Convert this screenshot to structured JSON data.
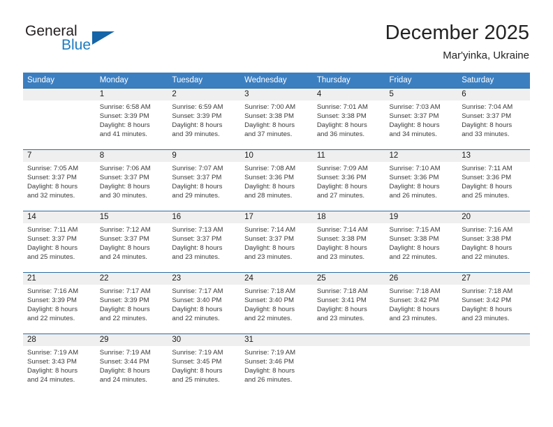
{
  "brand": {
    "name_part1": "General",
    "name_part2": "Blue",
    "logo_icon": "triangle-logo-icon"
  },
  "header": {
    "title": "December 2025",
    "location": "Mar'yinka, Ukraine"
  },
  "calendar": {
    "weekday_headers": [
      "Sunday",
      "Monday",
      "Tuesday",
      "Wednesday",
      "Thursday",
      "Friday",
      "Saturday"
    ],
    "colors": {
      "header_blue": "#3c7fc1",
      "rule_blue": "#2e6da4",
      "daynum_band": "#efefef",
      "brand_blue": "#1b7bc1"
    },
    "weeks": [
      {
        "days": [
          {
            "num": "",
            "sunrise": "",
            "sunset": "",
            "daylight1": "",
            "daylight2": ""
          },
          {
            "num": "1",
            "sunrise": "Sunrise: 6:58 AM",
            "sunset": "Sunset: 3:39 PM",
            "daylight1": "Daylight: 8 hours",
            "daylight2": "and 41 minutes."
          },
          {
            "num": "2",
            "sunrise": "Sunrise: 6:59 AM",
            "sunset": "Sunset: 3:39 PM",
            "daylight1": "Daylight: 8 hours",
            "daylight2": "and 39 minutes."
          },
          {
            "num": "3",
            "sunrise": "Sunrise: 7:00 AM",
            "sunset": "Sunset: 3:38 PM",
            "daylight1": "Daylight: 8 hours",
            "daylight2": "and 37 minutes."
          },
          {
            "num": "4",
            "sunrise": "Sunrise: 7:01 AM",
            "sunset": "Sunset: 3:38 PM",
            "daylight1": "Daylight: 8 hours",
            "daylight2": "and 36 minutes."
          },
          {
            "num": "5",
            "sunrise": "Sunrise: 7:03 AM",
            "sunset": "Sunset: 3:37 PM",
            "daylight1": "Daylight: 8 hours",
            "daylight2": "and 34 minutes."
          },
          {
            "num": "6",
            "sunrise": "Sunrise: 7:04 AM",
            "sunset": "Sunset: 3:37 PM",
            "daylight1": "Daylight: 8 hours",
            "daylight2": "and 33 minutes."
          }
        ]
      },
      {
        "days": [
          {
            "num": "7",
            "sunrise": "Sunrise: 7:05 AM",
            "sunset": "Sunset: 3:37 PM",
            "daylight1": "Daylight: 8 hours",
            "daylight2": "and 32 minutes."
          },
          {
            "num": "8",
            "sunrise": "Sunrise: 7:06 AM",
            "sunset": "Sunset: 3:37 PM",
            "daylight1": "Daylight: 8 hours",
            "daylight2": "and 30 minutes."
          },
          {
            "num": "9",
            "sunrise": "Sunrise: 7:07 AM",
            "sunset": "Sunset: 3:37 PM",
            "daylight1": "Daylight: 8 hours",
            "daylight2": "and 29 minutes."
          },
          {
            "num": "10",
            "sunrise": "Sunrise: 7:08 AM",
            "sunset": "Sunset: 3:36 PM",
            "daylight1": "Daylight: 8 hours",
            "daylight2": "and 28 minutes."
          },
          {
            "num": "11",
            "sunrise": "Sunrise: 7:09 AM",
            "sunset": "Sunset: 3:36 PM",
            "daylight1": "Daylight: 8 hours",
            "daylight2": "and 27 minutes."
          },
          {
            "num": "12",
            "sunrise": "Sunrise: 7:10 AM",
            "sunset": "Sunset: 3:36 PM",
            "daylight1": "Daylight: 8 hours",
            "daylight2": "and 26 minutes."
          },
          {
            "num": "13",
            "sunrise": "Sunrise: 7:11 AM",
            "sunset": "Sunset: 3:36 PM",
            "daylight1": "Daylight: 8 hours",
            "daylight2": "and 25 minutes."
          }
        ]
      },
      {
        "days": [
          {
            "num": "14",
            "sunrise": "Sunrise: 7:11 AM",
            "sunset": "Sunset: 3:37 PM",
            "daylight1": "Daylight: 8 hours",
            "daylight2": "and 25 minutes."
          },
          {
            "num": "15",
            "sunrise": "Sunrise: 7:12 AM",
            "sunset": "Sunset: 3:37 PM",
            "daylight1": "Daylight: 8 hours",
            "daylight2": "and 24 minutes."
          },
          {
            "num": "16",
            "sunrise": "Sunrise: 7:13 AM",
            "sunset": "Sunset: 3:37 PM",
            "daylight1": "Daylight: 8 hours",
            "daylight2": "and 23 minutes."
          },
          {
            "num": "17",
            "sunrise": "Sunrise: 7:14 AM",
            "sunset": "Sunset: 3:37 PM",
            "daylight1": "Daylight: 8 hours",
            "daylight2": "and 23 minutes."
          },
          {
            "num": "18",
            "sunrise": "Sunrise: 7:14 AM",
            "sunset": "Sunset: 3:38 PM",
            "daylight1": "Daylight: 8 hours",
            "daylight2": "and 23 minutes."
          },
          {
            "num": "19",
            "sunrise": "Sunrise: 7:15 AM",
            "sunset": "Sunset: 3:38 PM",
            "daylight1": "Daylight: 8 hours",
            "daylight2": "and 22 minutes."
          },
          {
            "num": "20",
            "sunrise": "Sunrise: 7:16 AM",
            "sunset": "Sunset: 3:38 PM",
            "daylight1": "Daylight: 8 hours",
            "daylight2": "and 22 minutes."
          }
        ]
      },
      {
        "days": [
          {
            "num": "21",
            "sunrise": "Sunrise: 7:16 AM",
            "sunset": "Sunset: 3:39 PM",
            "daylight1": "Daylight: 8 hours",
            "daylight2": "and 22 minutes."
          },
          {
            "num": "22",
            "sunrise": "Sunrise: 7:17 AM",
            "sunset": "Sunset: 3:39 PM",
            "daylight1": "Daylight: 8 hours",
            "daylight2": "and 22 minutes."
          },
          {
            "num": "23",
            "sunrise": "Sunrise: 7:17 AM",
            "sunset": "Sunset: 3:40 PM",
            "daylight1": "Daylight: 8 hours",
            "daylight2": "and 22 minutes."
          },
          {
            "num": "24",
            "sunrise": "Sunrise: 7:18 AM",
            "sunset": "Sunset: 3:40 PM",
            "daylight1": "Daylight: 8 hours",
            "daylight2": "and 22 minutes."
          },
          {
            "num": "25",
            "sunrise": "Sunrise: 7:18 AM",
            "sunset": "Sunset: 3:41 PM",
            "daylight1": "Daylight: 8 hours",
            "daylight2": "and 23 minutes."
          },
          {
            "num": "26",
            "sunrise": "Sunrise: 7:18 AM",
            "sunset": "Sunset: 3:42 PM",
            "daylight1": "Daylight: 8 hours",
            "daylight2": "and 23 minutes."
          },
          {
            "num": "27",
            "sunrise": "Sunrise: 7:18 AM",
            "sunset": "Sunset: 3:42 PM",
            "daylight1": "Daylight: 8 hours",
            "daylight2": "and 23 minutes."
          }
        ]
      },
      {
        "days": [
          {
            "num": "28",
            "sunrise": "Sunrise: 7:19 AM",
            "sunset": "Sunset: 3:43 PM",
            "daylight1": "Daylight: 8 hours",
            "daylight2": "and 24 minutes."
          },
          {
            "num": "29",
            "sunrise": "Sunrise: 7:19 AM",
            "sunset": "Sunset: 3:44 PM",
            "daylight1": "Daylight: 8 hours",
            "daylight2": "and 24 minutes."
          },
          {
            "num": "30",
            "sunrise": "Sunrise: 7:19 AM",
            "sunset": "Sunset: 3:45 PM",
            "daylight1": "Daylight: 8 hours",
            "daylight2": "and 25 minutes."
          },
          {
            "num": "31",
            "sunrise": "Sunrise: 7:19 AM",
            "sunset": "Sunset: 3:46 PM",
            "daylight1": "Daylight: 8 hours",
            "daylight2": "and 26 minutes."
          },
          {
            "num": "",
            "sunrise": "",
            "sunset": "",
            "daylight1": "",
            "daylight2": ""
          },
          {
            "num": "",
            "sunrise": "",
            "sunset": "",
            "daylight1": "",
            "daylight2": ""
          },
          {
            "num": "",
            "sunrise": "",
            "sunset": "",
            "daylight1": "",
            "daylight2": ""
          }
        ]
      }
    ]
  }
}
